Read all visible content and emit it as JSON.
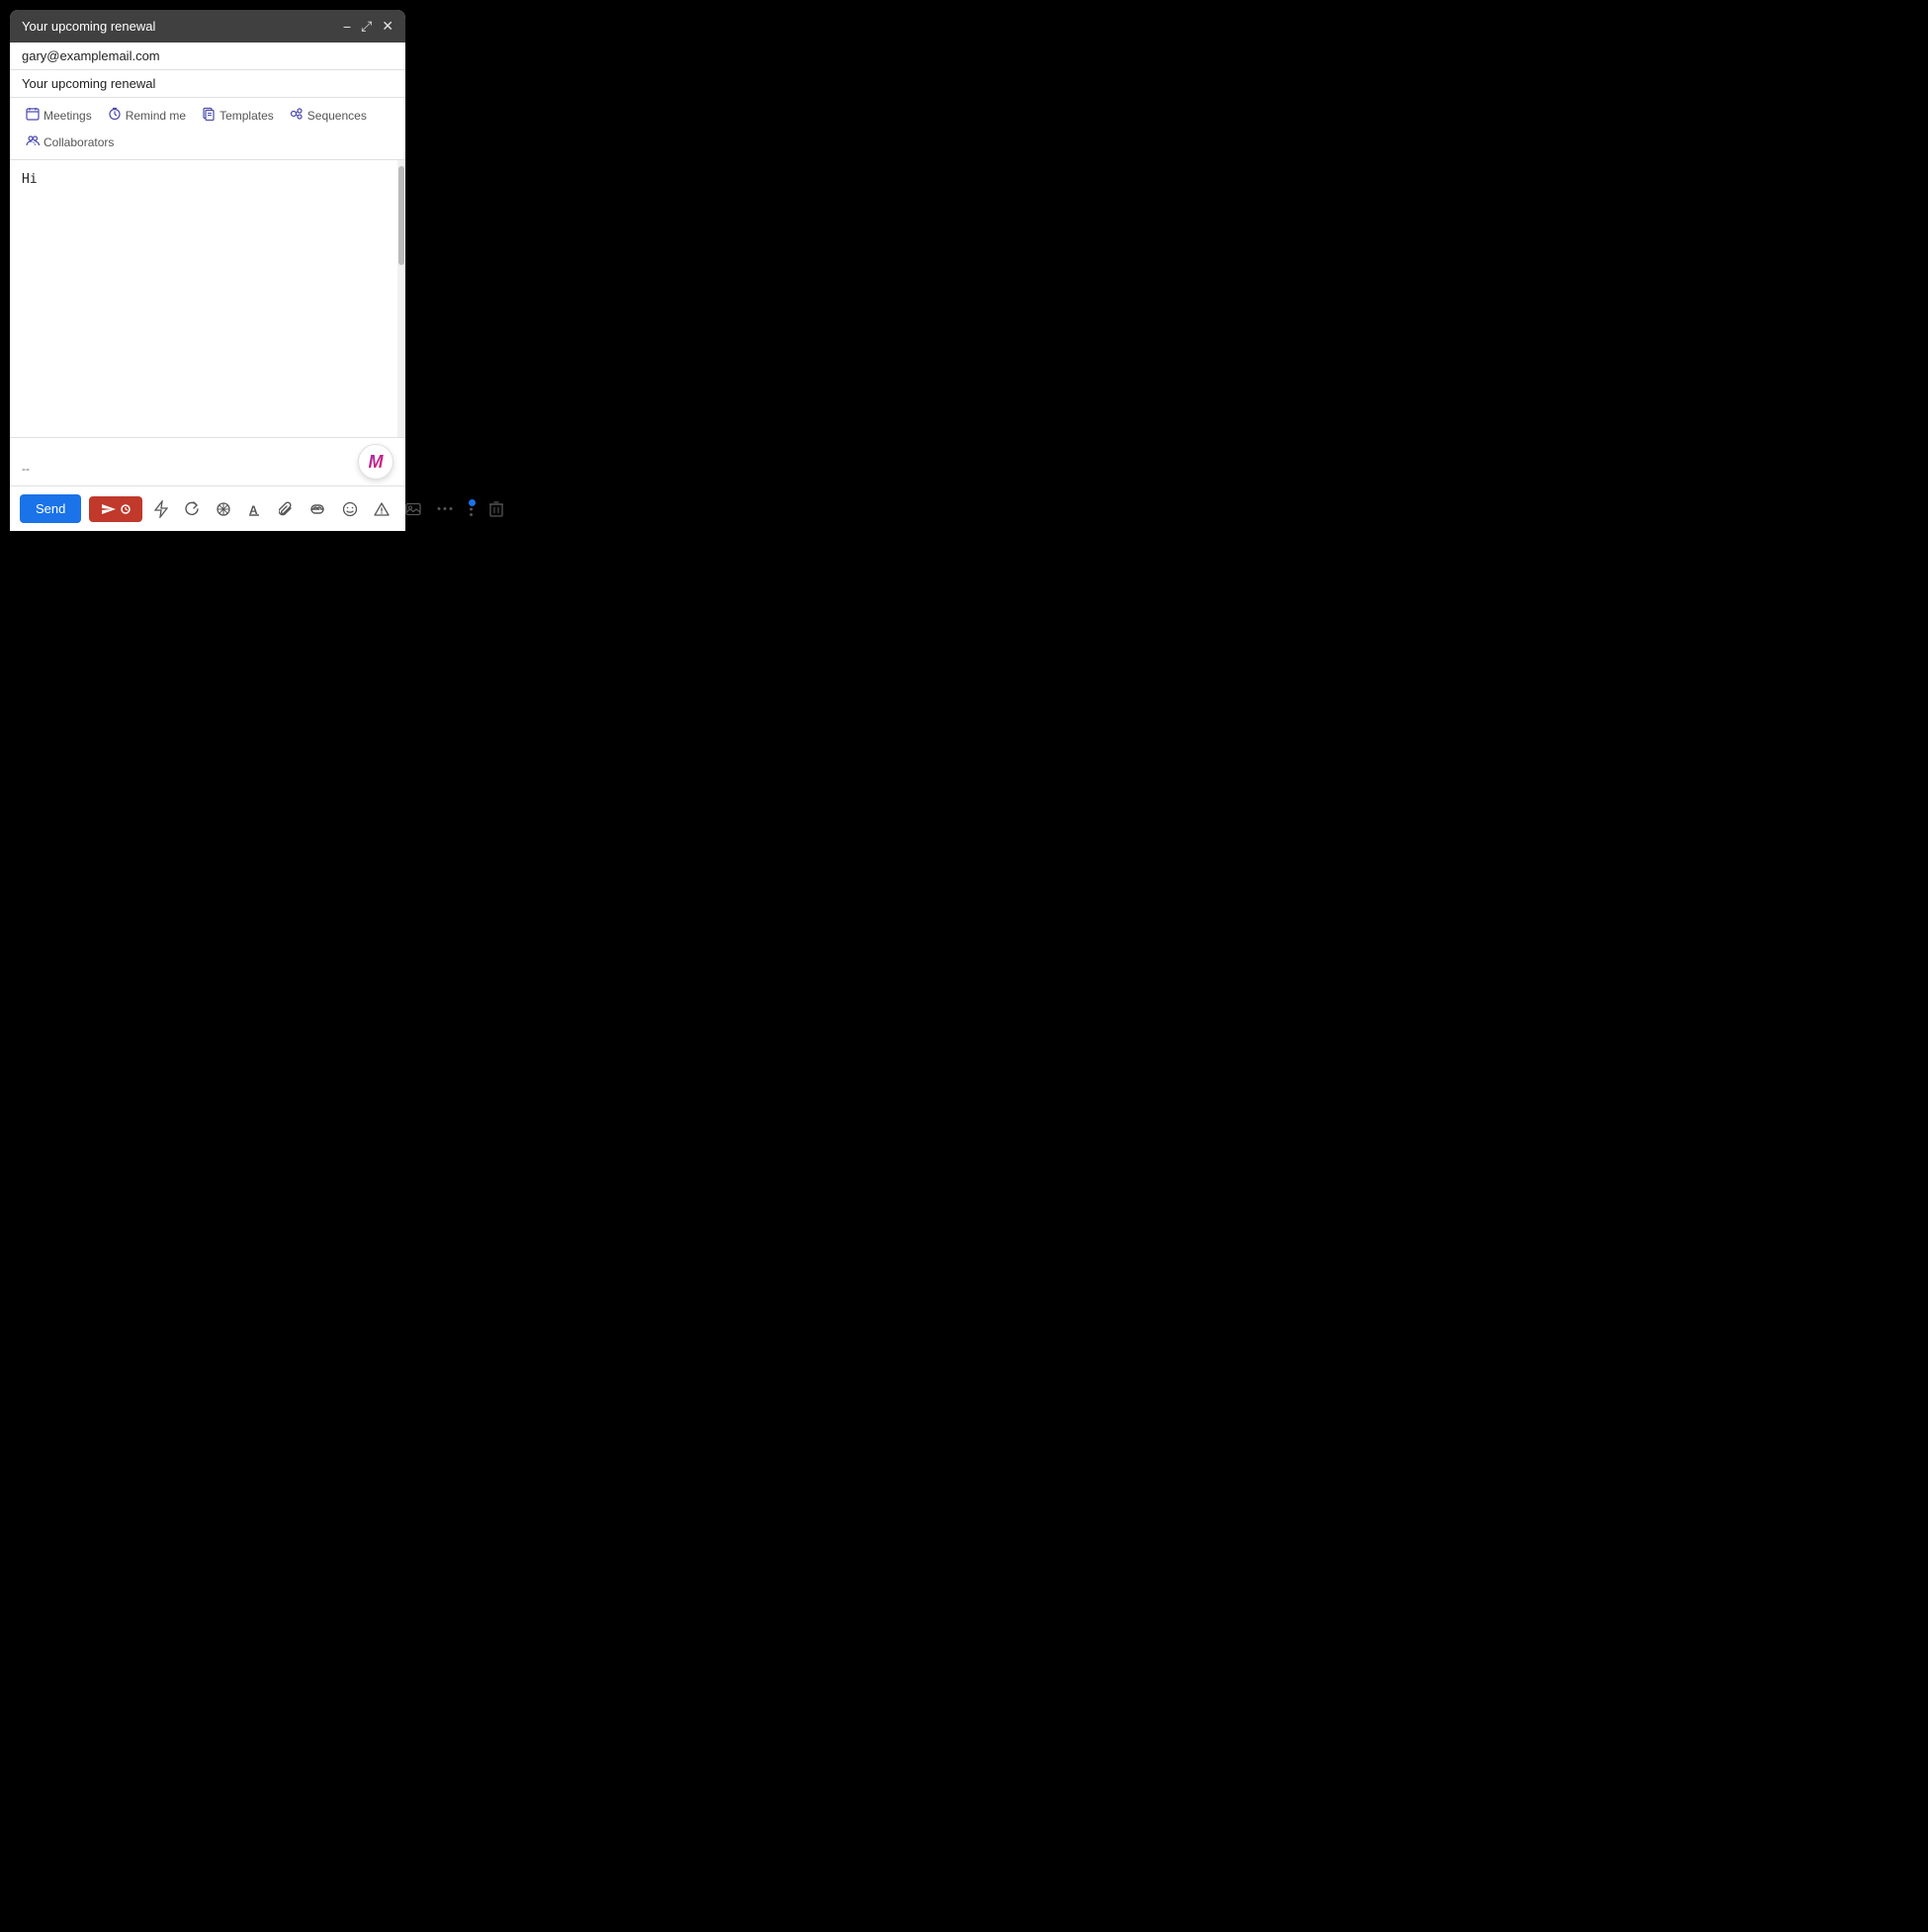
{
  "window": {
    "title": "Your upcoming renewal",
    "minimize_label": "−",
    "maximize_label": "⤢",
    "close_label": "✕"
  },
  "fields": {
    "to_placeholder": "gary@examplemail.com",
    "to_value": "gary@examplemail.com",
    "subject_value": "Your upcoming renewal"
  },
  "toolbar": {
    "meetings_label": "Meetings",
    "remind_me_label": "Remind me",
    "templates_label": "Templates",
    "sequences_label": "Sequences",
    "collaborators_label": "Collaborators"
  },
  "body": {
    "content": "Hi"
  },
  "footer": {
    "send_label": "Send",
    "signature": "--",
    "avatar_letter": "M"
  },
  "icons": {
    "minimize": "−",
    "maximize": "⤢",
    "close": "✕",
    "meetings": "▦",
    "remind": "⏰",
    "templates": "📋",
    "sequences": "◉",
    "collaborators": "👥",
    "lightning": "⚡",
    "refresh": "↻",
    "sparkle": "✳",
    "text_format": "A",
    "attach": "📎",
    "link": "🔗",
    "emoji": "☺",
    "warning": "△",
    "image": "▣",
    "more": "•••",
    "more_vert": "⋮",
    "trash": "🗑"
  }
}
